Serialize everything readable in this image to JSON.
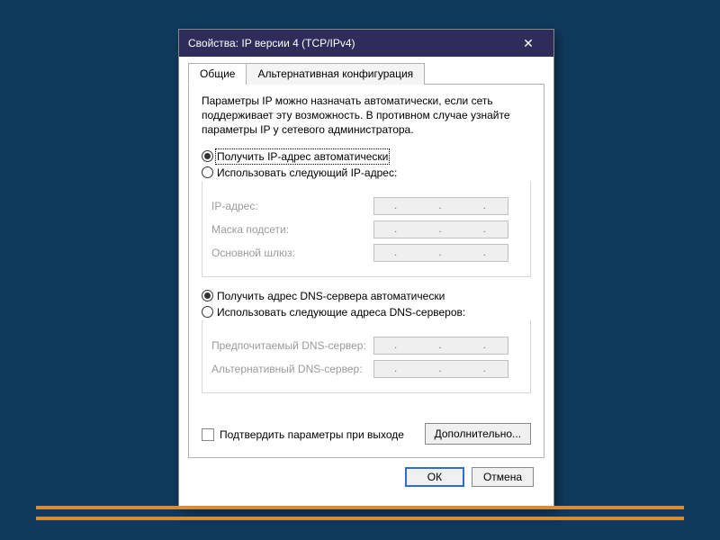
{
  "window": {
    "title": "Свойства: IP версии 4 (TCP/IPv4)",
    "close_glyph": "✕"
  },
  "tabs": {
    "general": "Общие",
    "alternate": "Альтернативная конфигурация"
  },
  "description": "Параметры IP можно назначать автоматически, если сеть поддерживает эту возможность. В противном случае узнайте параметры IP у сетевого администратора.",
  "ip_section": {
    "auto_label": "Получить IP-адрес автоматически",
    "manual_label": "Использовать следующий IP-адрес:",
    "auto_selected": true,
    "fields": {
      "ip": "IP-адрес:",
      "mask": "Маска подсети:",
      "gateway": "Основной шлюз:"
    }
  },
  "dns_section": {
    "auto_label": "Получить адрес DNS-сервера автоматически",
    "manual_label": "Использовать следующие адреса DNS-серверов:",
    "auto_selected": true,
    "fields": {
      "preferred": "Предпочитаемый DNS-сервер:",
      "alternate": "Альтернативный DNS-сервер:"
    }
  },
  "validate_checkbox": "Подтвердить параметры при выходе",
  "advanced_button": "Дополнительно...",
  "buttons": {
    "ok": "ОК",
    "cancel": "Отмена"
  }
}
